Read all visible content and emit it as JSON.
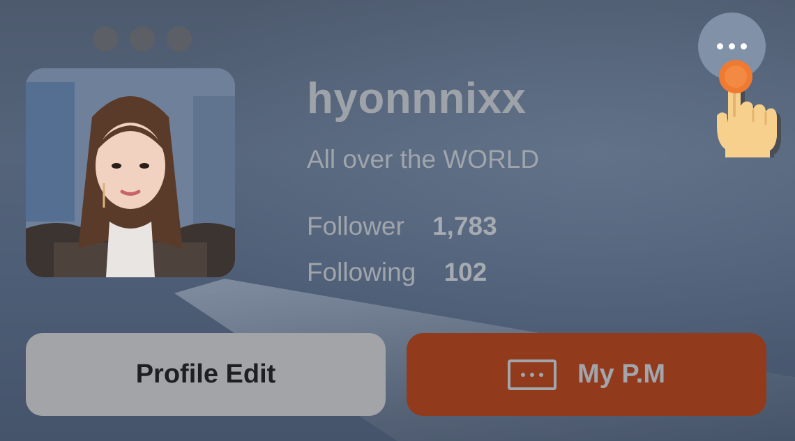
{
  "profile": {
    "username": "hyonnnixx",
    "bio": "All over the WORLD",
    "stats": {
      "follower_label": "Follower",
      "follower_count": "1,783",
      "following_label": "Following",
      "following_count": "102"
    }
  },
  "actions": {
    "edit_label": "Profile Edit",
    "pm_label": "My P.M"
  },
  "icons": {
    "more": "more-horizontal-icon",
    "tap_hint": "pointing-hand-icon",
    "message": "message-box-icon",
    "window_controls": "window-dots-icon"
  },
  "colors": {
    "pm_button": "#923a1c",
    "edit_button": "#a2a4a8",
    "more_button": "#8091a8",
    "tap_indicator": "#f07a30"
  }
}
